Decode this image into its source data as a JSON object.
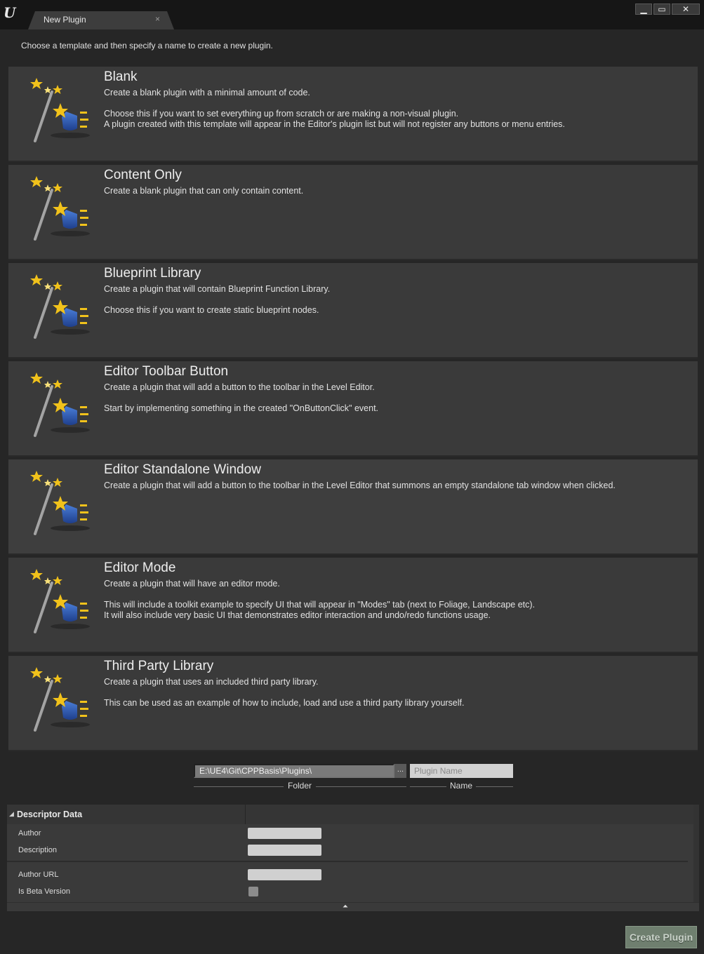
{
  "window": {
    "tab_title": "New Plugin",
    "tab_close": "×",
    "buttons": {
      "minimize": "▁",
      "maximize": "▭",
      "close": "✕"
    }
  },
  "instructions": "Choose a template and then specify a name to create a new plugin.",
  "templates": [
    {
      "title": "Blank",
      "lines": [
        "Create a blank plugin with a minimal amount of code.",
        "Choose this if you want to set everything up from scratch or are making a non-visual plugin.",
        "A plugin created with this template will appear in the Editor's plugin list but will not register any buttons or menu entries."
      ]
    },
    {
      "title": "Content Only",
      "lines": [
        "Create a blank plugin that can only contain content."
      ]
    },
    {
      "title": "Blueprint Library",
      "lines": [
        "Create a plugin that will contain Blueprint Function Library.",
        "Choose this if you want to create static blueprint nodes."
      ]
    },
    {
      "title": "Editor Toolbar Button",
      "lines": [
        "Create a plugin that will add a button to the toolbar in the Level Editor.",
        "Start by implementing something in the created \"OnButtonClick\" event."
      ]
    },
    {
      "title": "Editor Standalone Window",
      "lines": [
        "Create a plugin that will add a button to the toolbar in the Level Editor that summons an empty standalone tab window when clicked."
      ]
    },
    {
      "title": "Editor Mode",
      "lines": [
        "Create a plugin that will have an editor mode.",
        "This will include a toolkit example to specify UI that will appear in \"Modes\" tab (next to Foliage, Landscape etc).",
        "It will also include very basic UI that demonstrates editor interaction and undo/redo functions usage."
      ]
    },
    {
      "title": "Third Party Library",
      "lines": [
        "Create a plugin that uses an included third party library.",
        "This can be used as an example of how to include, load and use a third party library yourself."
      ]
    }
  ],
  "folder": {
    "value": "E:\\UE4\\Git\\CPPBasis\\Plugins\\",
    "caption": "Folder",
    "browse": "..."
  },
  "name": {
    "placeholder": "Plugin Name",
    "caption": "Name"
  },
  "descriptor": {
    "title": "Descriptor Data",
    "labels": {
      "author": "Author",
      "description": "Description",
      "author_url": "Author URL",
      "is_beta": "Is Beta Version"
    }
  },
  "create_button": "Create Plugin",
  "colors": {
    "background": "#262626",
    "card": "#3a3a3a",
    "create_button": "#6f7f6f"
  }
}
